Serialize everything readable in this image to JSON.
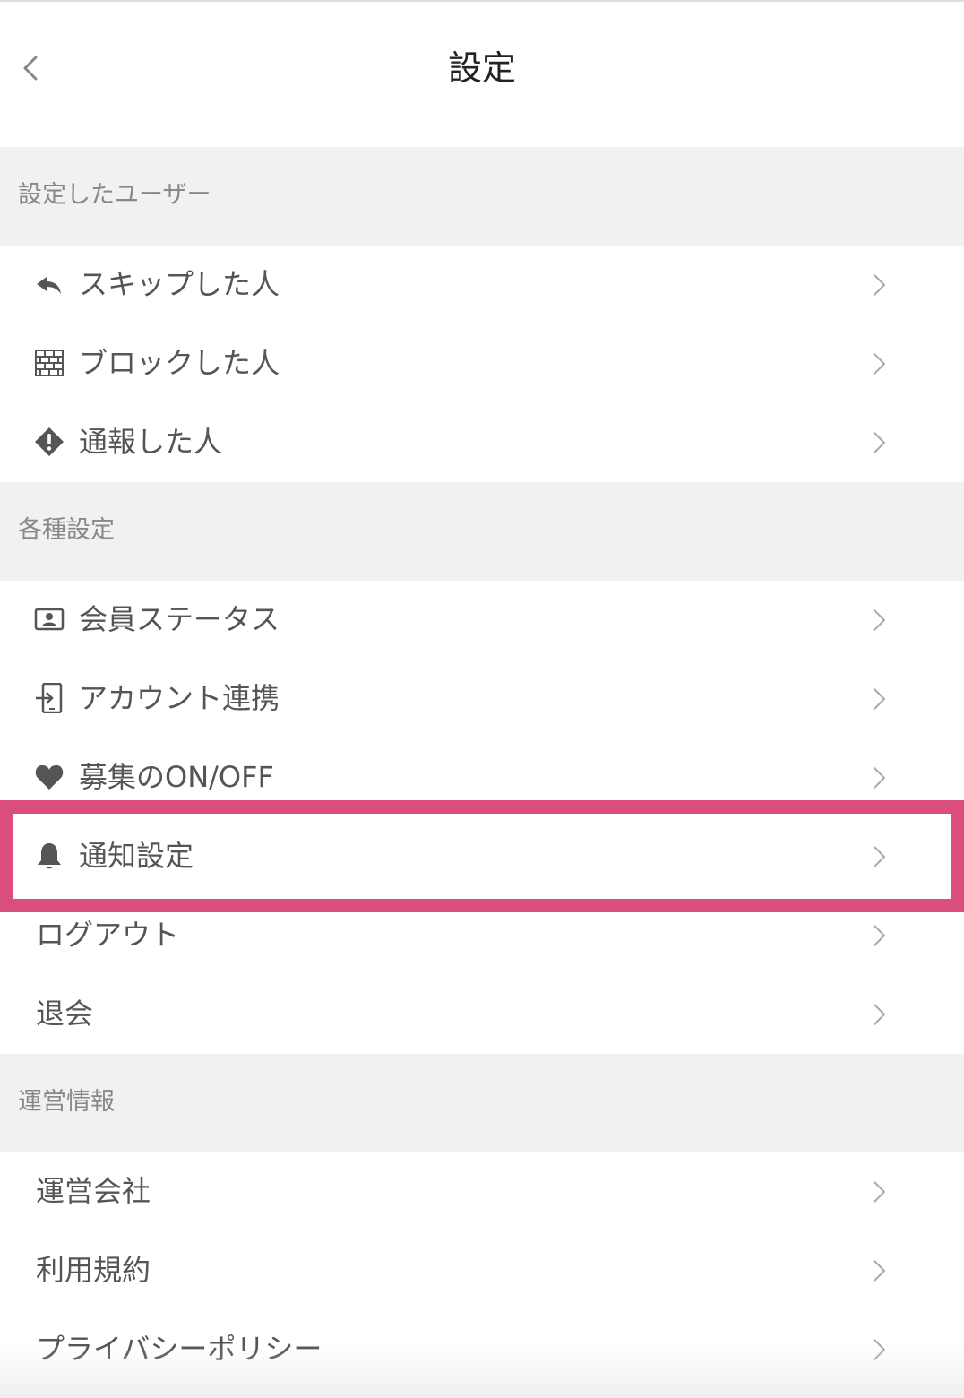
{
  "header": {
    "title": "設定"
  },
  "sections": {
    "users": {
      "title": "設定したユーザー",
      "items": [
        {
          "label": "スキップした人",
          "icon": "undo-arrow-icon"
        },
        {
          "label": "ブロックした人",
          "icon": "brick-wall-icon"
        },
        {
          "label": "通報した人",
          "icon": "warning-diamond-icon"
        }
      ]
    },
    "settings": {
      "title": "各種設定",
      "items": [
        {
          "label": "会員ステータス",
          "icon": "id-card-icon"
        },
        {
          "label": "アカウント連携",
          "icon": "login-device-icon"
        },
        {
          "label": "募集のON/OFF",
          "icon": "heart-icon"
        },
        {
          "label": "通知設定",
          "icon": "bell-icon"
        },
        {
          "label": "ログアウト"
        },
        {
          "label": "退会"
        }
      ]
    },
    "operation": {
      "title": "運営情報",
      "items": [
        {
          "label": "運営会社"
        },
        {
          "label": "利用規約"
        },
        {
          "label": "プライバシーポリシー"
        }
      ]
    }
  },
  "colors": {
    "highlight": "#d94d7f",
    "section_bg": "#f1f1f1",
    "text": "#555555"
  }
}
